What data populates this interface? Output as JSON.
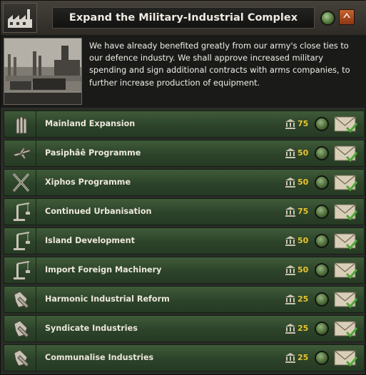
{
  "header": {
    "icon": "factory-icon",
    "title": "Expand the Military-Industrial Complex",
    "status_icon": "green-circle-icon",
    "collapse_icon": "chevron-up-icon"
  },
  "description": {
    "picture": "industrial-factory-photo",
    "text": "We have already benefited greatly from our army's close ties to our defence industry. We shall approve increased military spending and sign additional contracts with arms companies, to further increase production of equipment."
  },
  "decisions": [
    {
      "name": "Mainland Expansion",
      "icon": "artillery-shells-icon",
      "cost": "75"
    },
    {
      "name": "Pasiphâê Programme",
      "icon": "airplane-icon",
      "cost": "50"
    },
    {
      "name": "Xiphos Programme",
      "icon": "crossed-rifles-icon",
      "cost": "50"
    },
    {
      "name": "Continued Urbanisation",
      "icon": "crane-icon",
      "cost": "75"
    },
    {
      "name": "Island Development",
      "icon": "crane-icon",
      "cost": "50"
    },
    {
      "name": "Import Foreign Machinery",
      "icon": "crane-icon",
      "cost": "50"
    },
    {
      "name": "Harmonic Industrial Reform",
      "icon": "wrench-hand-icon",
      "cost": "25"
    },
    {
      "name": "Syndicate Industries",
      "icon": "wrench-hand-icon",
      "cost": "25"
    },
    {
      "name": "Communalise Industries",
      "icon": "wrench-hand-icon",
      "cost": "25"
    }
  ],
  "colors": {
    "row_green": "#2c4329",
    "cost_yellow": "#e8c530",
    "collapse_orange": "#c7632e",
    "status_green": "#547a3a"
  }
}
